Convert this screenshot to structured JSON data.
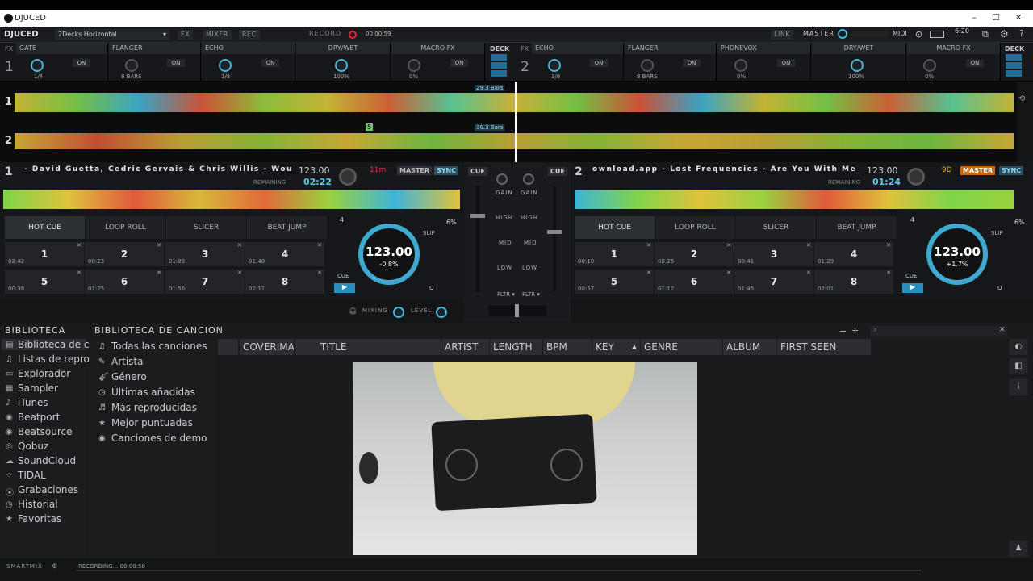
{
  "window": {
    "title": "DJUCED",
    "controls": [
      "–",
      "☐",
      "✕"
    ]
  },
  "topbar": {
    "brand": "DJUCED",
    "layout": "2Decks Horizontal",
    "fx": "FX",
    "mixer": "MIXER",
    "rec": "REC",
    "record_label": "RECORD",
    "record_time": "00:00:59",
    "link": "LINK",
    "master": "MASTER",
    "midi": "MIDI",
    "clock": "6:20"
  },
  "fx": {
    "left": {
      "label": "FX",
      "deck": "1",
      "slots": [
        {
          "name": "GATE",
          "value": "1/4",
          "on": "ON"
        },
        {
          "name": "FLANGER",
          "value": "8 BARS",
          "on": "ON"
        },
        {
          "name": "ECHO",
          "value": "1/8",
          "on": "ON"
        },
        {
          "name": "DRY/WET",
          "value": "100%"
        },
        {
          "name": "MACRO FX",
          "value": "0%",
          "on": "ON"
        }
      ]
    },
    "right": {
      "label": "FX",
      "deck": "2",
      "slots": [
        {
          "name": "ECHO",
          "value": "3/8",
          "on": "ON"
        },
        {
          "name": "FLANGER",
          "value": "8 BARS",
          "on": "ON"
        },
        {
          "name": "PHONEVOX",
          "value": "0%",
          "on": "ON"
        },
        {
          "name": "DRY/WET",
          "value": "100%"
        },
        {
          "name": "MACRO FX",
          "value": "0%",
          "on": "ON"
        }
      ]
    },
    "deck_label": "DECK"
  },
  "waveforms": {
    "deck1_num": "1",
    "deck2_num": "2",
    "bars1": "29.3 Bars",
    "bars2": "30.3 Bars",
    "marker": "5"
  },
  "deck1": {
    "num": "1",
    "track": "- David Guetta, Cedric Gervais & Chris Willis - Would I L",
    "bpm": "123.00",
    "remaining_label": "REMAINING",
    "time": "02:22",
    "key": "11m",
    "master": "MASTER",
    "sync": "SYNC",
    "pitch_bpm": "123.00",
    "pitch_pct": "-0.8%",
    "slip": "SLIP",
    "loop": "4",
    "pct": "6%",
    "cue": "CUE",
    "q": "Q"
  },
  "deck2": {
    "num": "2",
    "track": "ownload.app - Lost Frequencies - Are You With Me (Of",
    "bpm": "123.00",
    "remaining_label": "REMAINING",
    "time": "01:24",
    "key": "9D",
    "master": "MASTER",
    "sync": "SYNC",
    "pitch_bpm": "123.00",
    "pitch_pct": "+1.7%",
    "slip": "SLIP",
    "loop": "4",
    "pct": "6%",
    "cue": "CUE",
    "q": "Q"
  },
  "pad_tabs": [
    "HOT CUE",
    "LOOP ROLL",
    "SLICER",
    "BEAT JUMP"
  ],
  "pads1": [
    {
      "n": "1",
      "t": "02:42"
    },
    {
      "n": "2",
      "t": "00:23"
    },
    {
      "n": "3",
      "t": "01:09"
    },
    {
      "n": "4",
      "t": "01:40"
    },
    {
      "n": "5",
      "t": "00:38"
    },
    {
      "n": "6",
      "t": "01:25"
    },
    {
      "n": "7",
      "t": "01:56"
    },
    {
      "n": "8",
      "t": "02:11"
    }
  ],
  "pads2": [
    {
      "n": "1",
      "t": "00:10"
    },
    {
      "n": "2",
      "t": "00:25"
    },
    {
      "n": "3",
      "t": "00:41"
    },
    {
      "n": "4",
      "t": "01:29"
    },
    {
      "n": "5",
      "t": "00:57"
    },
    {
      "n": "6",
      "t": "01:12"
    },
    {
      "n": "7",
      "t": "01:45"
    },
    {
      "n": "8",
      "t": "02:01"
    }
  ],
  "mixer": {
    "cue": "CUE",
    "gain": "GAIN",
    "high": "HIGH",
    "mid": "MID",
    "low": "LOW",
    "fltr": "FLTR ▾",
    "mixing": "MIXING",
    "level": "LEVEL"
  },
  "library": {
    "title": "BIBLIOTECA",
    "subtitle": "BIBLIOTECA DE CANCION",
    "sidebar": [
      "Biblioteca de c",
      "Listas de repro",
      "Explorador",
      "Sampler",
      "iTunes",
      "Beatport",
      "Beatsource",
      "Qobuz",
      "SoundCloud",
      "TIDAL",
      "Grabaciones",
      "Historial",
      "Favoritas"
    ],
    "sub": [
      "Todas las canciones",
      "Artista",
      "Género",
      "Últimas añadidas",
      "Más reproducidas",
      "Mejor puntuadas",
      "Canciones de demo"
    ],
    "columns": [
      "COVERIMA",
      "TITLE",
      "ARTIST",
      "LENGTH",
      "BPM",
      "KEY",
      "GENRE",
      "ALBUM",
      "FIRST SEEN"
    ]
  },
  "status": {
    "smartmix": "SMARTMIX",
    "recording": "RECORDING... 00:00:58"
  }
}
